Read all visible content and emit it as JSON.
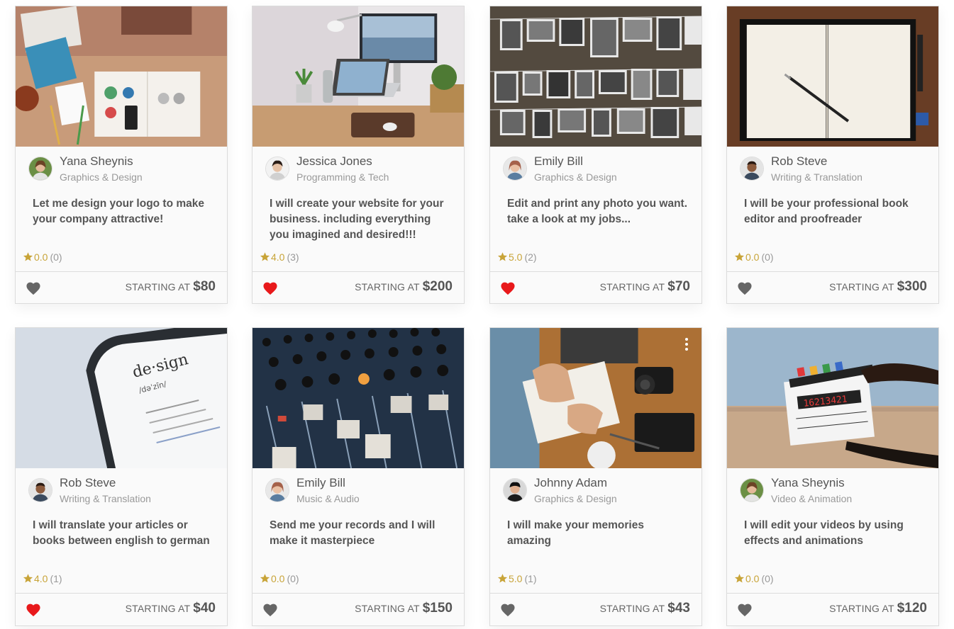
{
  "gigs": [
    {
      "seller": "Yana Sheynis",
      "category": "Graphics & Design",
      "title": "Let me design your logo to make your company attractive!",
      "rating": "0.0",
      "reviews": "(0)",
      "starting_label": "STARTING AT",
      "price": "$80",
      "favorited": false,
      "image": "design-desk-photo",
      "avatar": "yana-avatar"
    },
    {
      "seller": "Jessica Jones",
      "category": "Programming & Tech",
      "title": "I will create your website for your business. including everything you imagined and desired!!!",
      "rating": "4.0",
      "reviews": "(3)",
      "starting_label": "STARTING AT",
      "price": "$200",
      "favorited": true,
      "image": "laptop-workspace-photo",
      "avatar": "jessica-avatar"
    },
    {
      "seller": "Emily Bill",
      "category": "Graphics & Design",
      "title": "Edit and print any photo you want. take a look at my jobs...",
      "rating": "5.0",
      "reviews": "(2)",
      "starting_label": "STARTING AT",
      "price": "$70",
      "favorited": true,
      "image": "hanging-photos-photo",
      "avatar": "emily-avatar"
    },
    {
      "seller": "Rob Steve",
      "category": "Writing & Translation",
      "title": "I will be your professional book editor and proofreader",
      "rating": "0.0",
      "reviews": "(0)",
      "starting_label": "STARTING AT",
      "price": "$300",
      "favorited": false,
      "image": "notebook-pen-photo",
      "avatar": "rob-avatar"
    },
    {
      "seller": "Rob Steve",
      "category": "Writing & Translation",
      "title": "I will translate your articles or books between english to german",
      "rating": "4.0",
      "reviews": "(1)",
      "starting_label": "STARTING AT",
      "price": "$40",
      "favorited": true,
      "image": "dictionary-phone-photo",
      "avatar": "rob-avatar"
    },
    {
      "seller": "Emily Bill",
      "category": "Music & Audio",
      "title": "Send me your records and I will make it masterpiece",
      "rating": "0.0",
      "reviews": "(0)",
      "starting_label": "STARTING AT",
      "price": "$150",
      "favorited": false,
      "image": "mixing-console-photo",
      "avatar": "emily-avatar"
    },
    {
      "seller": "Johnny Adam",
      "category": "Graphics & Design",
      "title": "I will make your memories amazing",
      "rating": "5.0",
      "reviews": "(1)",
      "starting_label": "STARTING AT",
      "price": "$43",
      "favorited": false,
      "image": "sketching-camera-photo",
      "avatar": "johnny-avatar"
    },
    {
      "seller": "Yana Sheynis",
      "category": "Video & Animation",
      "title": "I will edit your videos by using effects and animations",
      "rating": "0.0",
      "reviews": "(0)",
      "starting_label": "STARTING AT",
      "price": "$120",
      "favorited": false,
      "image": "clapperboard-photo",
      "avatar": "yana-avatar"
    }
  ],
  "colors": {
    "heart_active": "#e8191b",
    "heart_inactive": "#666666",
    "star": "#c8a438"
  }
}
